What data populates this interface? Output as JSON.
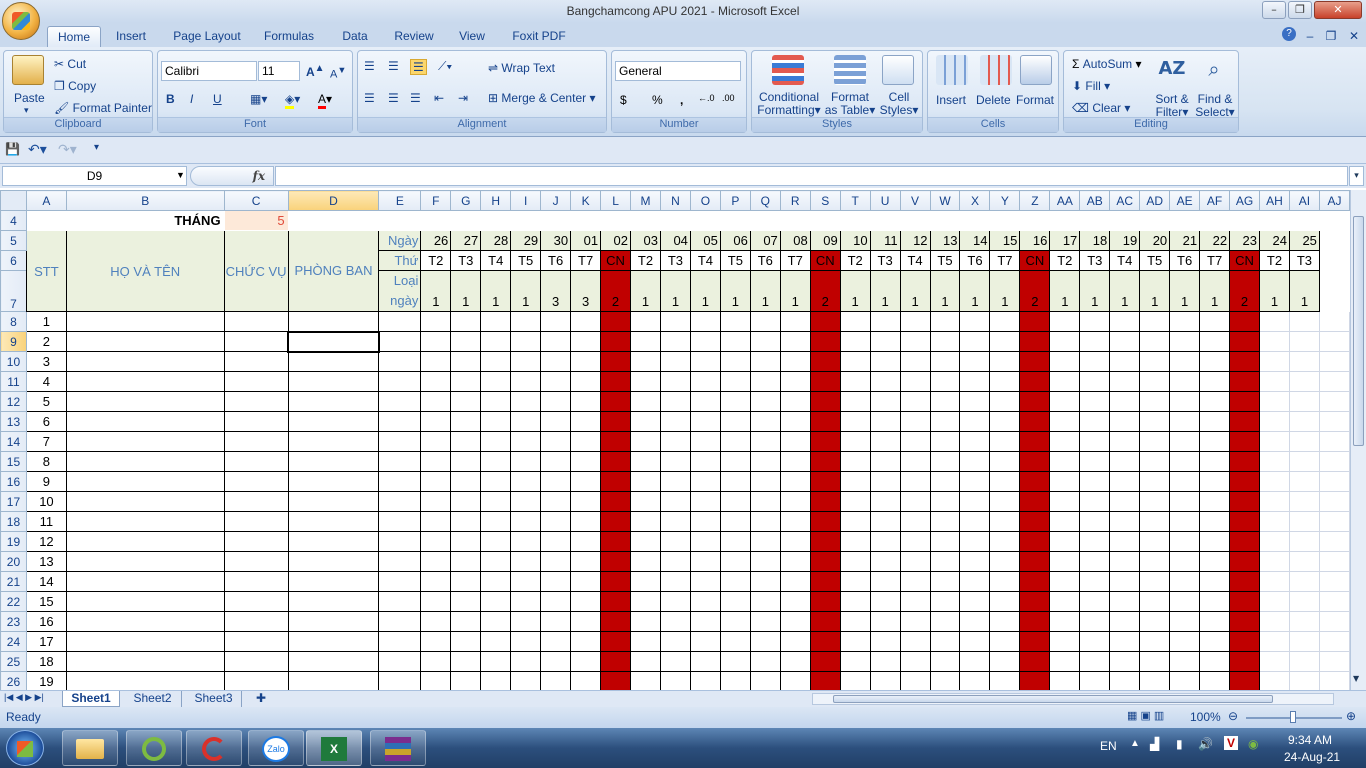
{
  "window": {
    "title": "Bangchamcong APU 2021 - Microsoft Excel"
  },
  "ribbon_tabs": [
    "Home",
    "Insert",
    "Page Layout",
    "Formulas",
    "Data",
    "Review",
    "View",
    "Foxit PDF"
  ],
  "clipboard": {
    "paste": "Paste",
    "cut": "Cut",
    "copy": "Copy",
    "format_painter": "Format Painter",
    "label": "Clipboard"
  },
  "font": {
    "name": "Calibri",
    "size": "11",
    "bold": "B",
    "italic": "I",
    "underline": "U",
    "label": "Font"
  },
  "alignment": {
    "wrap_text": "Wrap Text",
    "merge_center": "Merge & Center",
    "label": "Alignment"
  },
  "number": {
    "format": "General",
    "currency": "$",
    "percent": "%",
    "comma": ",",
    "label": "Number"
  },
  "styles": {
    "conditional": "Conditional",
    "conditional2": "Formatting",
    "format_as": "Format",
    "format_as2": "as Table",
    "cell": "Cell",
    "cell2": "Styles",
    "label": "Styles"
  },
  "cells": {
    "insert": "Insert",
    "delete": "Delete",
    "format": "Format",
    "label": "Cells"
  },
  "editing": {
    "autosum": "AutoSum",
    "fill": "Fill",
    "clear": "Clear",
    "sort": "Sort &",
    "sort2": "Filter",
    "find": "Find &",
    "find2": "Select",
    "label": "Editing"
  },
  "formula_bar": {
    "name_box": "D9",
    "fx": "fx",
    "value": ""
  },
  "columns": [
    "A",
    "B",
    "C",
    "D",
    "E",
    "F",
    "G",
    "H",
    "I",
    "J",
    "K",
    "L",
    "M",
    "N",
    "O",
    "P",
    "Q",
    "R",
    "S",
    "T",
    "U",
    "V",
    "W",
    "X",
    "Y",
    "Z",
    "AA",
    "AB",
    "AC",
    "AD",
    "AE",
    "AF",
    "AG",
    "AH",
    "AI",
    "AJ"
  ],
  "sheet": {
    "month_label": "THÁNG",
    "month_value": "5",
    "headers": {
      "stt": "STT",
      "name": "HỌ VÀ TÊN",
      "position": "CHỨC VỤ",
      "department": "PHÒNG BAN",
      "day": "Ngày",
      "weekday": "Thứ",
      "type1": "Loại",
      "type2": "ngày"
    },
    "days": [
      "26",
      "27",
      "28",
      "29",
      "30",
      "01",
      "02",
      "03",
      "04",
      "05",
      "06",
      "07",
      "08",
      "09",
      "10",
      "11",
      "12",
      "13",
      "14",
      "15",
      "16",
      "17",
      "18",
      "19",
      "20",
      "21",
      "22",
      "23",
      "24",
      "25"
    ],
    "weekdays": [
      "T2",
      "T3",
      "T4",
      "T5",
      "T6",
      "T7",
      "CN",
      "T2",
      "T3",
      "T4",
      "T5",
      "T6",
      "T7",
      "CN",
      "T2",
      "T3",
      "T4",
      "T5",
      "T6",
      "T7",
      "CN",
      "T2",
      "T3",
      "T4",
      "T5",
      "T6",
      "T7",
      "CN",
      "T2",
      "T3"
    ],
    "day_types": [
      "1",
      "1",
      "1",
      "1",
      "3",
      "3",
      "2",
      "1",
      "1",
      "1",
      "1",
      "1",
      "1",
      "2",
      "1",
      "1",
      "1",
      "1",
      "1",
      "1",
      "2",
      "1",
      "1",
      "1",
      "1",
      "1",
      "1",
      "2",
      "1",
      "1"
    ],
    "row_numbers": [
      "8",
      "9",
      "10",
      "11",
      "12",
      "13",
      "14",
      "15",
      "16",
      "17",
      "18",
      "19",
      "20",
      "21",
      "22",
      "23",
      "24",
      "25",
      "26"
    ],
    "stt": [
      "1",
      "2",
      "3",
      "4",
      "5",
      "6",
      "7",
      "8",
      "9",
      "10",
      "11",
      "12",
      "13",
      "14",
      "15",
      "16",
      "17",
      "18",
      "19"
    ]
  },
  "sheet_tabs": [
    "Sheet1",
    "Sheet2",
    "Sheet3"
  ],
  "status": {
    "ready": "Ready",
    "zoom": "100%"
  },
  "taskbar": {
    "lang": "EN",
    "time": "9:34 AM",
    "date": "24-Aug-21",
    "zalo": "Zalo"
  },
  "colors": {
    "cn_red": "#c00000",
    "header_green": "#ebf1de",
    "header_text": "#4f81bd",
    "month_bg": "#fde9d9",
    "selected_header": "#f9d27a"
  }
}
